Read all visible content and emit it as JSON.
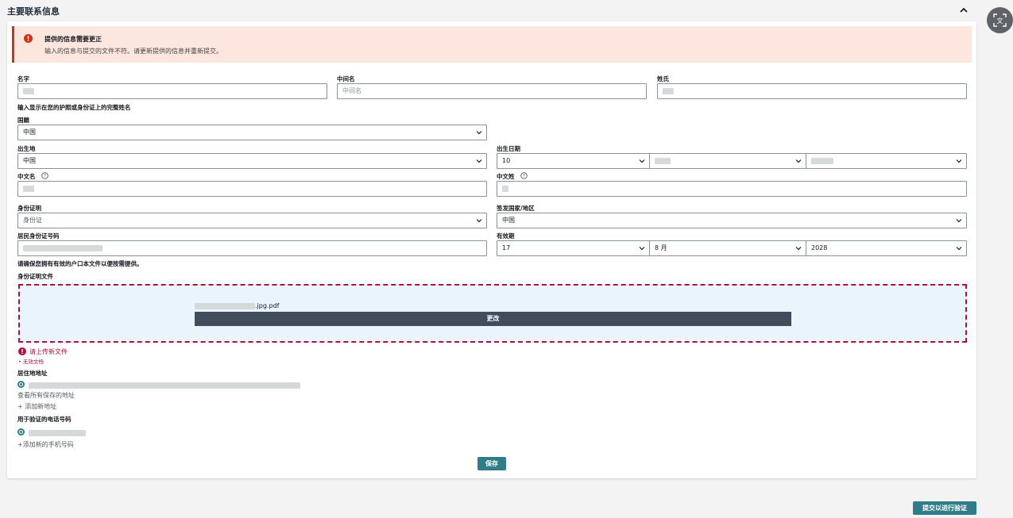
{
  "section": {
    "title": "主要联系信息"
  },
  "alert": {
    "title": "提供的信息需要更正",
    "message": "输入的信息与提交的文件不符。请更新提供的信息并重新提交。"
  },
  "name": {
    "first_label": "名字",
    "middle_label": "中间名",
    "middle_placeholder": "中间名",
    "last_label": "姓氏",
    "hint": "输入显示在您的护照或身份证上的完整姓名"
  },
  "nationality": {
    "label": "国籍",
    "value": "中国"
  },
  "birthplace": {
    "label": "出生地",
    "value": "中国"
  },
  "birthdate": {
    "label": "出生日期",
    "day": "10"
  },
  "chinese_given": {
    "label": "中文名"
  },
  "chinese_surname": {
    "label": "中文姓"
  },
  "id_proof": {
    "label": "身份证明",
    "value": "身份证"
  },
  "issuing_country": {
    "label": "签发国家/地区",
    "value": "中国"
  },
  "id_number": {
    "label": "居民身份证号码"
  },
  "expiry": {
    "label": "有效期",
    "day": "17",
    "month": "8 月",
    "year": "2028"
  },
  "hukou_hint": "请确保您拥有有效的户口本文件以便按需提供。",
  "id_document": {
    "label": "身份证明文件",
    "file_suffix": ".jpg.pdf",
    "change_label": "更改",
    "error": "请上传新文件",
    "error_detail": "•  无效文档"
  },
  "address": {
    "label": "居住地地址",
    "view_all": "查看所有保存的地址",
    "add_new": "+ 添加新地址"
  },
  "phone": {
    "label": "用于验证的电话号码",
    "add_new": "+添加新的手机号码"
  },
  "buttons": {
    "save": "保存",
    "submit": "提交以进行验证"
  },
  "colors": {
    "accent": "#2f7e87",
    "error": "#b0113c",
    "alert_bg": "#fde6de",
    "alert_border": "#d13212",
    "dark_button": "#414d5c"
  },
  "icons": {
    "collapse": "chevron-up-icon",
    "alert": "exclamation-circle-icon",
    "help": "question-circle-icon",
    "dropdown": "chevron-down-icon",
    "translate": "translate-icon"
  }
}
